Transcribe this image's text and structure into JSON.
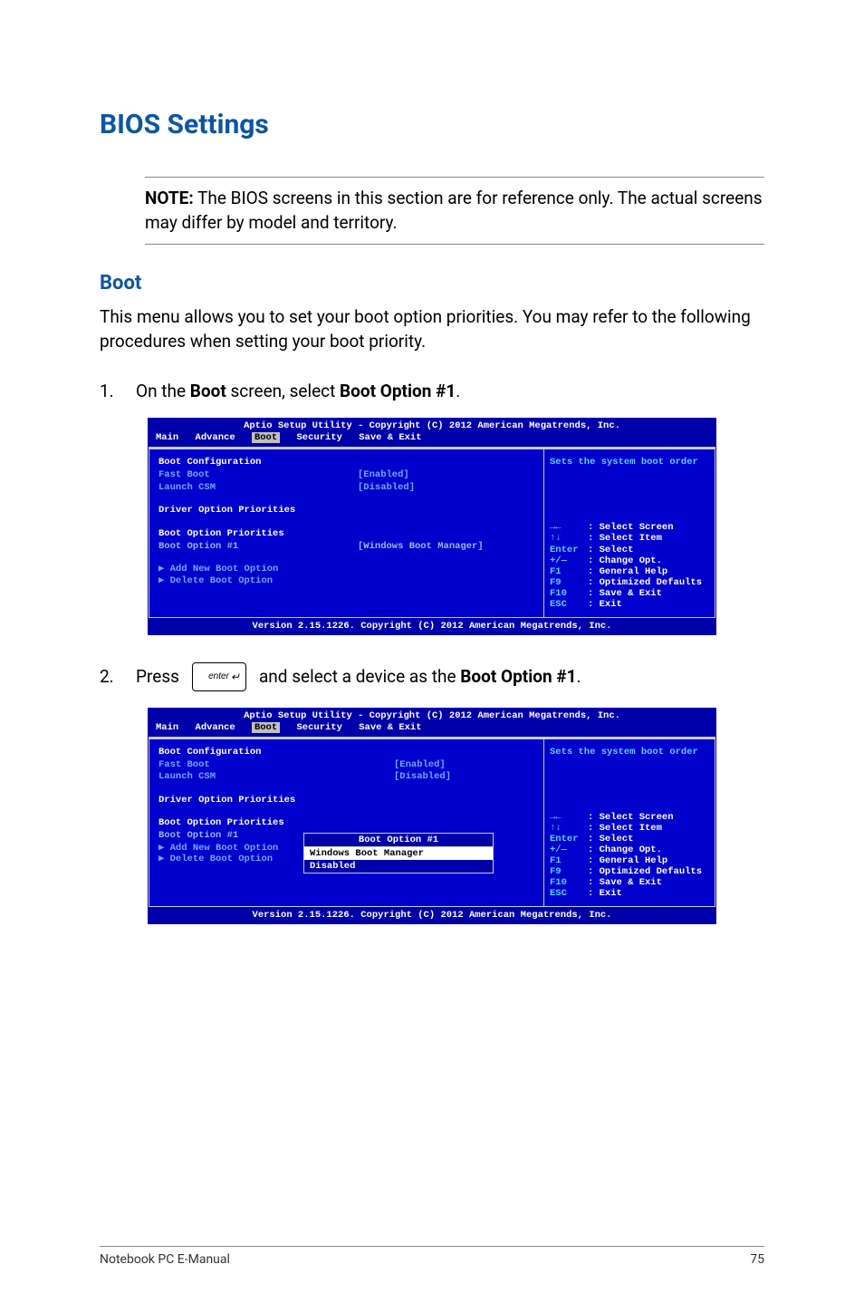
{
  "headings": {
    "section": "BIOS Settings",
    "boot": "Boot"
  },
  "note": {
    "label": "NOTE:",
    "text": " The BIOS screens in this section are for reference only. The actual screens may differ by model and territory."
  },
  "intro": "This menu allows you to set your boot option priorities. You may refer to the following procedures when setting your boot priority.",
  "steps": {
    "s1_num": "1.",
    "s1_a": "On the ",
    "s1_b": "Boot",
    "s1_c": " screen, select ",
    "s1_d": "Boot Option #1",
    "s1_e": ".",
    "s2_num": "2.",
    "s2_a": "Press",
    "s2_b": "and select a device as the ",
    "s2_c": "Boot Option #1",
    "s2_d": "."
  },
  "key": {
    "enter": "enter"
  },
  "bios": {
    "title": "Aptio Setup Utility - Copyright (C) 2012 American Megatrends, Inc.",
    "tabs": {
      "main": "Main",
      "advance": "Advance",
      "boot": "Boot",
      "security": "Security",
      "save_exit": "Save & Exit"
    },
    "left": {
      "boot_config": "Boot Configuration",
      "fast_boot": "Fast Boot",
      "fast_boot_val": "[Enabled]",
      "launch_csm": "Launch CSM",
      "launch_csm_val": "[Disabled]",
      "driver_prio": "Driver Option Priorities",
      "boot_prio": "Boot Option Priorities",
      "boot_opt1": "Boot Option #1",
      "boot_opt1_val": "[Windows Boot Manager]",
      "add_new": "Add New Boot Option",
      "delete_opt": "Delete Boot Option"
    },
    "right": {
      "help_top": "Sets the system boot order",
      "k_arrows": "→←",
      "k_arrows_t": ": Select Screen",
      "k_ud": "↑↓",
      "k_ud_t": ": Select Item",
      "k_enter": "Enter",
      "k_enter_t": ": Select",
      "k_pm": "+/—",
      "k_pm_t": ": Change Opt.",
      "k_f1": "F1",
      "k_f1_t": ": General Help",
      "k_f9": "F9",
      "k_f9_t": ": Optimized Defaults",
      "k_f10": "F10",
      "k_f10_t": ": Save & Exit",
      "k_esc": "ESC",
      "k_esc_t": ": Exit"
    },
    "footer": "Version 2.15.1226. Copyright (C) 2012 American Megatrends, Inc.",
    "popup": {
      "title": "Boot Option #1",
      "opt1": "Windows Boot Manager",
      "opt2": "Disabled"
    }
  },
  "footer": {
    "left": "Notebook PC E-Manual",
    "right": "75"
  }
}
